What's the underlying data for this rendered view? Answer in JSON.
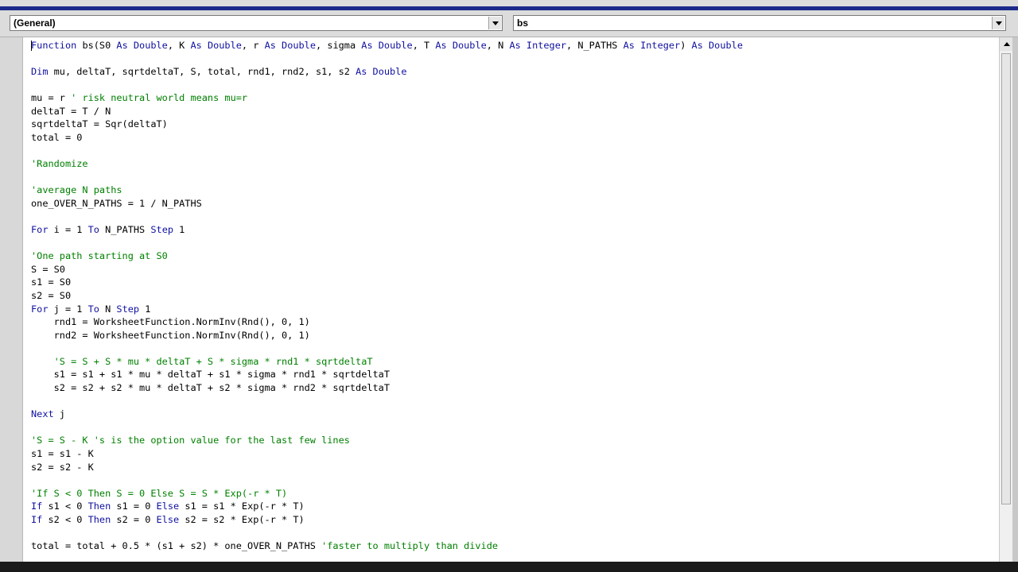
{
  "header": {
    "object_combo": {
      "value": "(General)"
    },
    "procedure_combo": {
      "value": "bs"
    }
  },
  "colors": {
    "keyword": "#1010a0",
    "comment": "#008000",
    "text": "#000000",
    "background": "#ffffff",
    "window_title_bar": "#1b2a8a"
  },
  "icons": [
    "chevron-down-icon",
    "scroll-up-arrow-icon"
  ],
  "code": {
    "language": "VBA",
    "lines": [
      [
        {
          "t": "Function",
          "c": "kw"
        },
        {
          "t": " bs(S0 "
        },
        {
          "t": "As Double",
          "c": "kw"
        },
        {
          "t": ", K "
        },
        {
          "t": "As Double",
          "c": "kw"
        },
        {
          "t": ", r "
        },
        {
          "t": "As Double",
          "c": "kw"
        },
        {
          "t": ", sigma "
        },
        {
          "t": "As Double",
          "c": "kw"
        },
        {
          "t": ", T "
        },
        {
          "t": "As Double",
          "c": "kw"
        },
        {
          "t": ", N "
        },
        {
          "t": "As Integer",
          "c": "kw"
        },
        {
          "t": ", N_PATHS "
        },
        {
          "t": "As Integer",
          "c": "kw"
        },
        {
          "t": ") "
        },
        {
          "t": "As Double",
          "c": "kw"
        }
      ],
      [],
      [
        {
          "t": "Dim",
          "c": "kw"
        },
        {
          "t": " mu, deltaT, sqrtdeltaT, S, total, rnd1, rnd2, s1, s2 "
        },
        {
          "t": "As Double",
          "c": "kw"
        }
      ],
      [],
      [
        {
          "t": "mu = r "
        },
        {
          "t": "' risk neutral world means mu=r",
          "c": "cm"
        }
      ],
      [
        {
          "t": "deltaT = T / N"
        }
      ],
      [
        {
          "t": "sqrtdeltaT = Sqr(deltaT)"
        }
      ],
      [
        {
          "t": "total = 0"
        }
      ],
      [],
      [
        {
          "t": "'Randomize",
          "c": "cm"
        }
      ],
      [],
      [
        {
          "t": "'average N paths",
          "c": "cm"
        }
      ],
      [
        {
          "t": "one_OVER_N_PATHS = 1 / N_PATHS"
        }
      ],
      [],
      [
        {
          "t": "For",
          "c": "kw"
        },
        {
          "t": " i = 1 "
        },
        {
          "t": "To",
          "c": "kw"
        },
        {
          "t": " N_PATHS "
        },
        {
          "t": "Step",
          "c": "kw"
        },
        {
          "t": " 1"
        }
      ],
      [],
      [
        {
          "t": "'One path starting at S0",
          "c": "cm"
        }
      ],
      [
        {
          "t": "S = S0"
        }
      ],
      [
        {
          "t": "s1 = S0"
        }
      ],
      [
        {
          "t": "s2 = S0"
        }
      ],
      [
        {
          "t": "For",
          "c": "kw"
        },
        {
          "t": " j = 1 "
        },
        {
          "t": "To",
          "c": "kw"
        },
        {
          "t": " N "
        },
        {
          "t": "Step",
          "c": "kw"
        },
        {
          "t": " 1"
        }
      ],
      [
        {
          "t": "    rnd1 = WorksheetFunction.NormInv(Rnd(), 0, 1)"
        }
      ],
      [
        {
          "t": "    rnd2 = WorksheetFunction.NormInv(Rnd(), 0, 1)"
        }
      ],
      [],
      [
        {
          "t": "    "
        },
        {
          "t": "'S = S + S * mu * deltaT + S * sigma * rnd1 * sqrtdeltaT",
          "c": "cm"
        }
      ],
      [
        {
          "t": "    s1 = s1 + s1 * mu * deltaT + s1 * sigma * rnd1 * sqrtdeltaT"
        }
      ],
      [
        {
          "t": "    s2 = s2 + s2 * mu * deltaT + s2 * sigma * rnd2 * sqrtdeltaT"
        }
      ],
      [],
      [
        {
          "t": "Next",
          "c": "kw"
        },
        {
          "t": " j"
        }
      ],
      [],
      [
        {
          "t": "'S = S - K 's is the option value for the last few lines",
          "c": "cm"
        }
      ],
      [
        {
          "t": "s1 = s1 - K"
        }
      ],
      [
        {
          "t": "s2 = s2 - K"
        }
      ],
      [],
      [
        {
          "t": "'If S < 0 Then S = 0 Else S = S * Exp(-r * T)",
          "c": "cm"
        }
      ],
      [
        {
          "t": "If",
          "c": "kw"
        },
        {
          "t": " s1 < 0 "
        },
        {
          "t": "Then",
          "c": "kw"
        },
        {
          "t": " s1 = 0 "
        },
        {
          "t": "Else",
          "c": "kw"
        },
        {
          "t": " s1 = s1 * Exp(-r * T)"
        }
      ],
      [
        {
          "t": "If",
          "c": "kw"
        },
        {
          "t": " s2 < 0 "
        },
        {
          "t": "Then",
          "c": "kw"
        },
        {
          "t": " s2 = 0 "
        },
        {
          "t": "Else",
          "c": "kw"
        },
        {
          "t": " s2 = s2 * Exp(-r * T)"
        }
      ],
      [],
      [
        {
          "t": "total = total + 0.5 * (s1 + s2) * one_OVER_N_PATHS "
        },
        {
          "t": "'faster to multiply than divide",
          "c": "cm"
        }
      ]
    ]
  }
}
